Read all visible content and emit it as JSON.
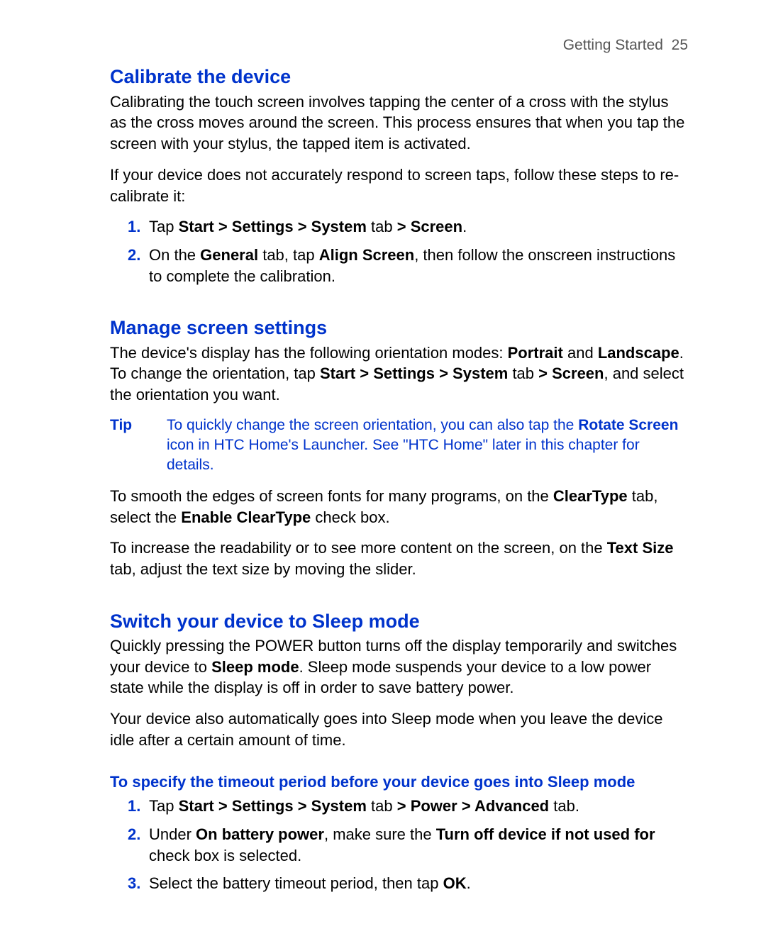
{
  "header": {
    "section": "Getting Started",
    "page": "25"
  },
  "s1": {
    "title": "Calibrate the device",
    "p1": "Calibrating the touch screen involves tapping the center of a cross with the stylus as the cross moves around the screen. This process ensures that when you tap the screen with your stylus, the tapped item is activated.",
    "p2": "If your device does not accurately respond to screen taps, follow these steps to re-calibrate it:",
    "li1": {
      "n": "1.",
      "a": "Tap ",
      "b": "Start > Settings > System",
      "c": " tab ",
      "d": "> Screen",
      "e": "."
    },
    "li2": {
      "n": "2.",
      "a": "On the ",
      "b": "General",
      "c": " tab, tap ",
      "d": "Align Screen",
      "e": ", then follow the onscreen instructions to complete the calibration."
    }
  },
  "s2": {
    "title": "Manage screen settings",
    "p1a": "The device's display has the following orientation modes: ",
    "p1b": "Portrait",
    "p1c": " and ",
    "p1d": "Landscape",
    "p1e": ". To change the orientation, tap ",
    "p1f": "Start > Settings > System",
    "p1g": " tab ",
    "p1h": "> Screen",
    "p1i": ", and select the orientation you want.",
    "tip_label": "Tip",
    "tip_a": "To quickly change the screen orientation, you can also tap the ",
    "tip_b": "Rotate Screen",
    "tip_c": " icon in HTC Home's Launcher. See \"HTC Home\" later in this chapter for details.",
    "p2a": "To smooth the edges of screen fonts for many programs, on the ",
    "p2b": "ClearType",
    "p2c": " tab, select the ",
    "p2d": "Enable ClearType",
    "p2e": " check box.",
    "p3a": "To increase the readability or to see more content on the screen, on the ",
    "p3b": "Text Size",
    "p3c": " tab, adjust the text size by moving the slider."
  },
  "s3": {
    "title": "Switch your device to Sleep mode",
    "p1a": "Quickly pressing the POWER button turns off the display temporarily and switches your device to ",
    "p1b": "Sleep mode",
    "p1c": ". Sleep mode suspends your device to a low power state while the display is off in order to save battery power.",
    "p2": "Your device also automatically goes into Sleep mode when you leave the device idle after a certain amount of time.",
    "h3": "To specify the timeout period before your device goes into Sleep mode",
    "li1": {
      "n": "1.",
      "a": "Tap ",
      "b": "Start > Settings > System",
      "c": " tab ",
      "d": "> Power > Advanced",
      "e": " tab."
    },
    "li2": {
      "n": "2.",
      "a": "Under ",
      "b": "On battery power",
      "c": ", make sure the ",
      "d": "Turn off device if not used for",
      "e": " check box is selected."
    },
    "li3": {
      "n": "3.",
      "a": "Select the battery timeout period, then tap ",
      "b": "OK",
      "c": "."
    }
  }
}
